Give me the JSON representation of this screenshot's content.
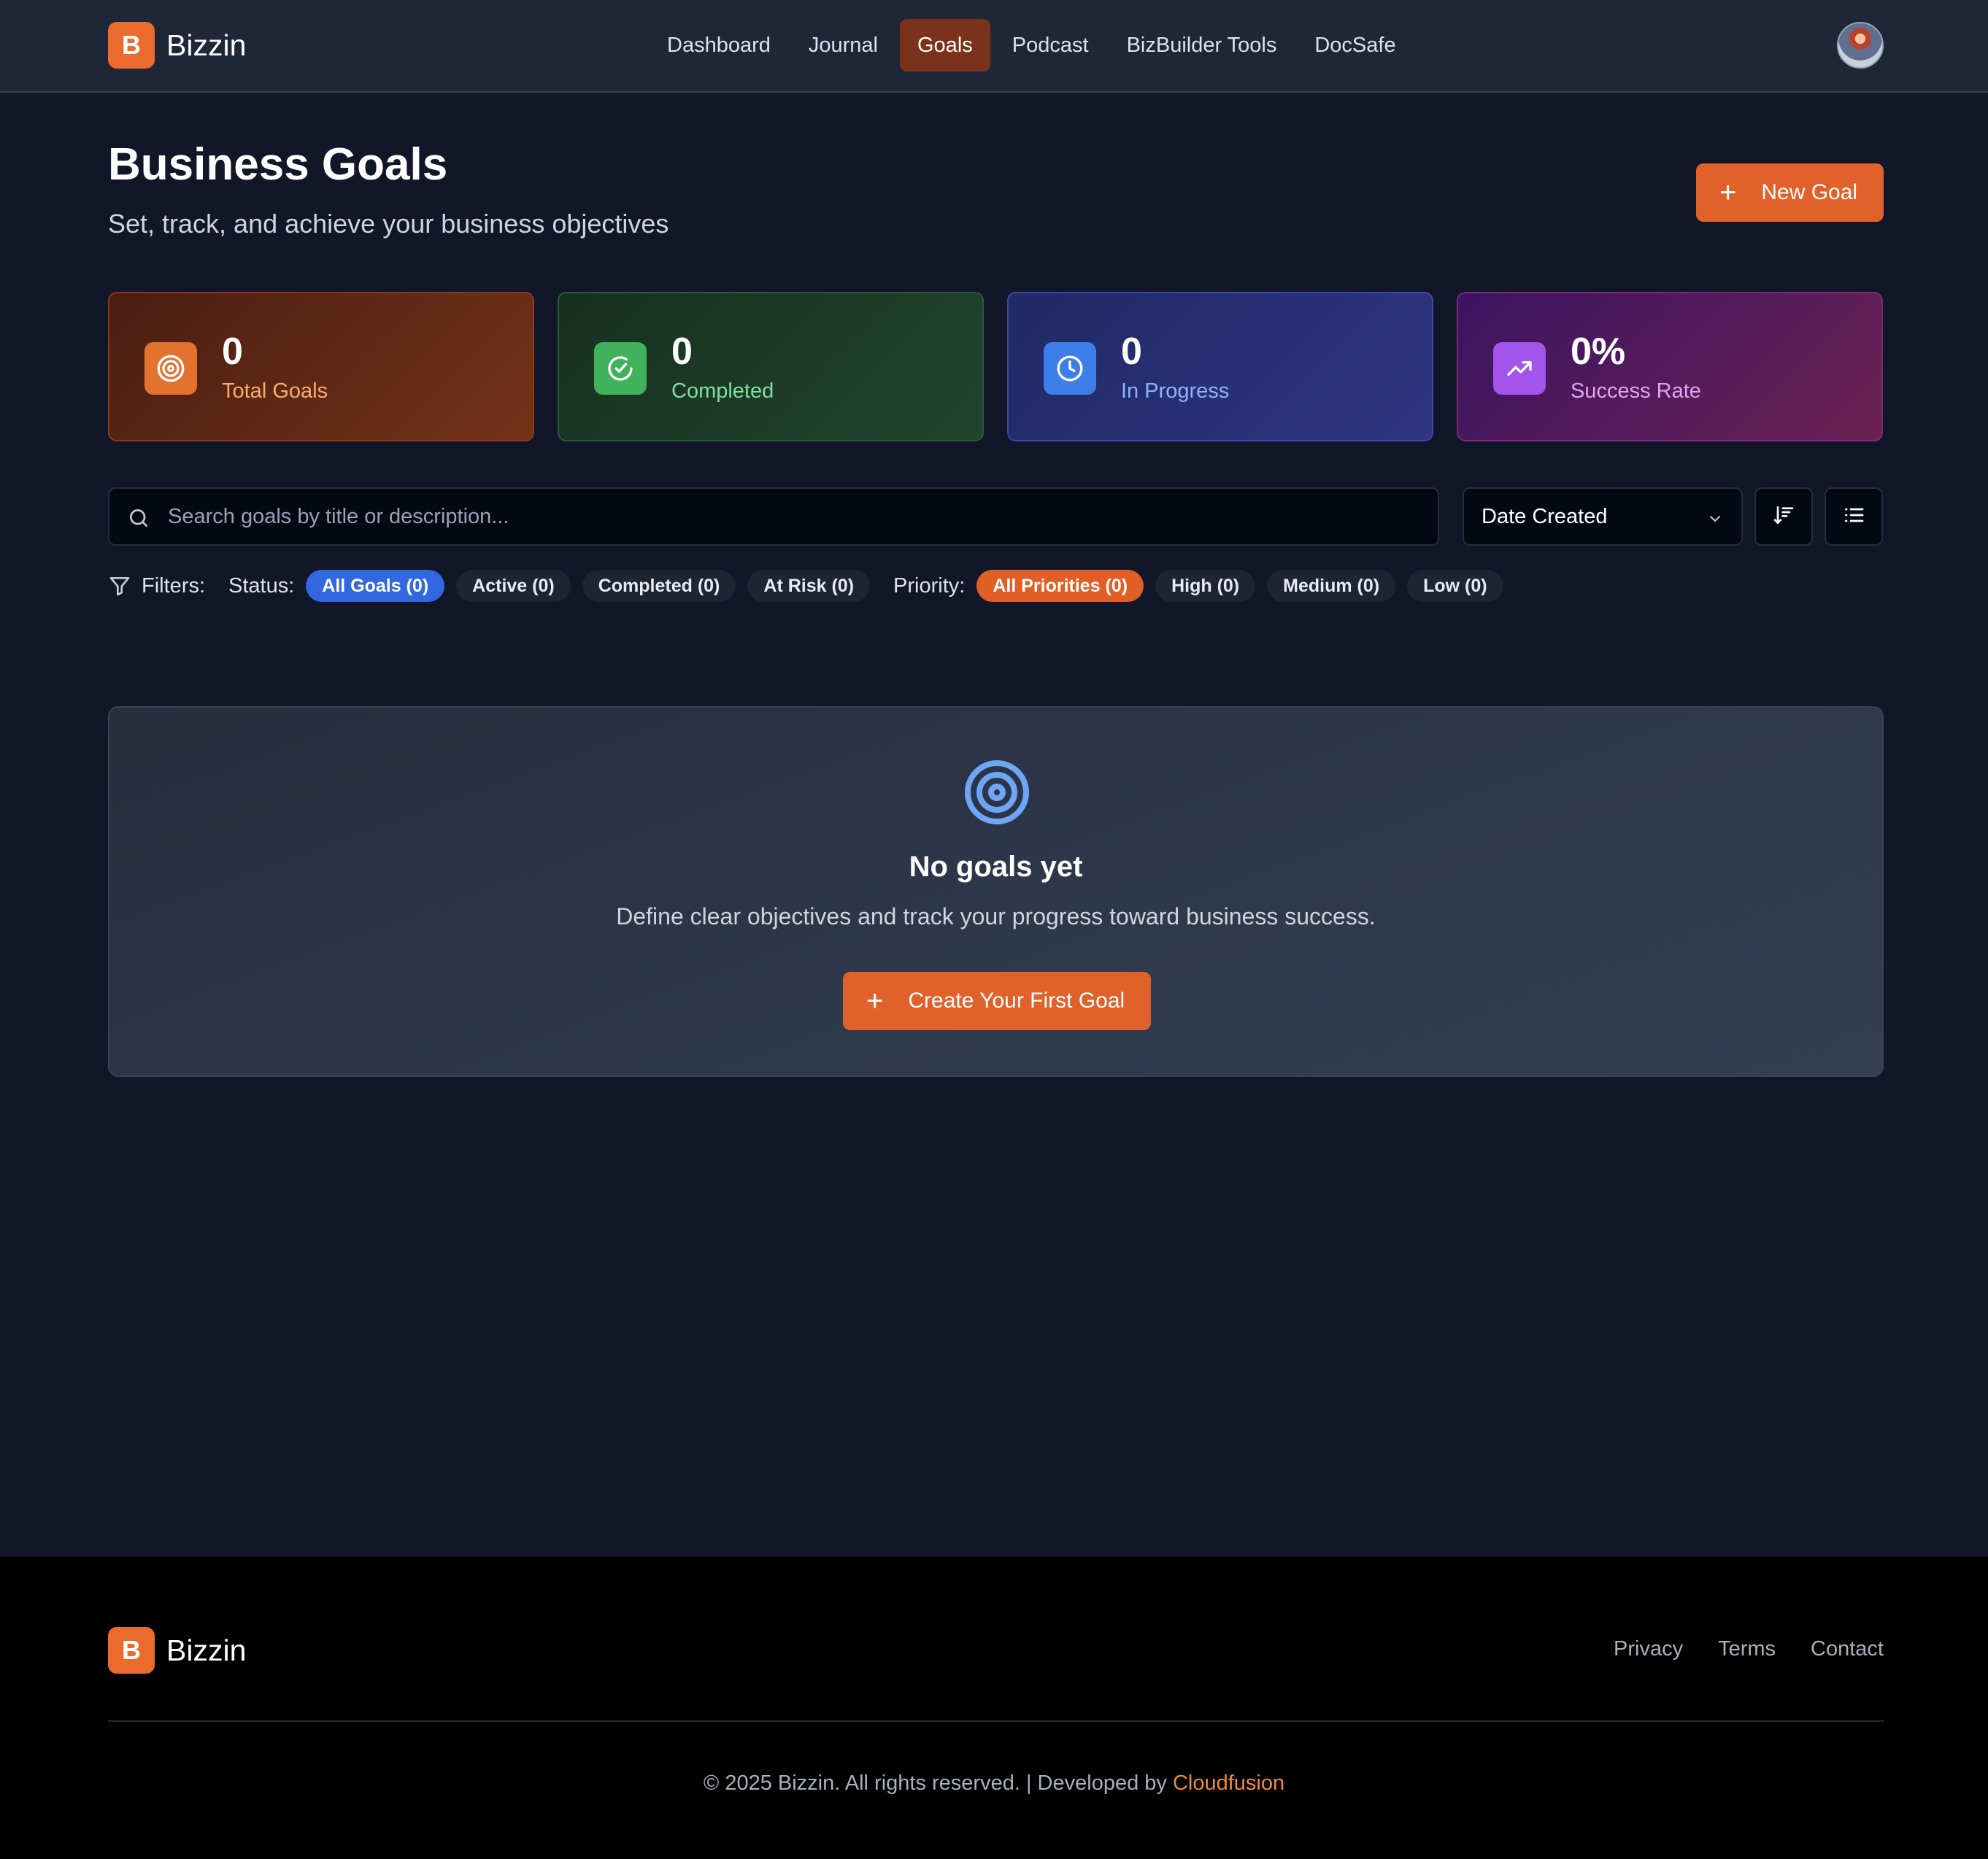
{
  "brand": {
    "logo_letter": "B",
    "name": "Bizzin",
    "accent": "#e0622a"
  },
  "nav": {
    "items": [
      {
        "label": "Dashboard"
      },
      {
        "label": "Journal"
      },
      {
        "label": "Goals",
        "active": true
      },
      {
        "label": "Podcast"
      },
      {
        "label": "BizBuilder Tools"
      },
      {
        "label": "DocSafe"
      }
    ]
  },
  "header": {
    "avatar_icon": "user-avatar"
  },
  "page": {
    "title": "Business Goals",
    "subtitle": "Set, track, and achieve your business objectives",
    "new_goal_label": "New Goal"
  },
  "stats": {
    "total": {
      "value": "0",
      "label": "Total Goals",
      "icon": "target-icon"
    },
    "completed": {
      "value": "0",
      "label": "Completed",
      "icon": "check-circle-icon"
    },
    "in_progress": {
      "value": "0",
      "label": "In Progress",
      "icon": "clock-icon"
    },
    "success_rate": {
      "value": "0%",
      "label": "Success Rate",
      "icon": "trending-up-icon"
    }
  },
  "search": {
    "placeholder": "Search goals by title or description...",
    "value": ""
  },
  "sort": {
    "selected": "Date Created"
  },
  "filters": {
    "label": "Filters:",
    "status_label": "Status:",
    "status": [
      "All Goals (0)",
      "Active (0)",
      "Completed (0)",
      "At Risk (0)"
    ],
    "priority_label": "Priority:",
    "priority": [
      "All Priorities (0)",
      "High (0)",
      "Medium (0)",
      "Low (0)"
    ]
  },
  "empty_state": {
    "title": "No goals yet",
    "description": "Define clear objectives and track your progress toward business success.",
    "button_label": "Create Your First Goal"
  },
  "footer": {
    "links": [
      "Privacy",
      "Terms",
      "Contact"
    ],
    "copyright": "© 2025 Bizzin. All rights reserved. | Developed by ",
    "developer": "Cloudfusion"
  }
}
